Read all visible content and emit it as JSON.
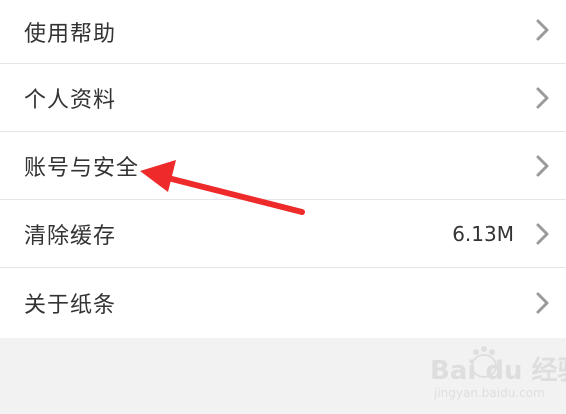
{
  "menu": {
    "items": [
      {
        "label": "使用帮助"
      },
      {
        "label": "个人资料"
      },
      {
        "label": "账号与安全"
      },
      {
        "label": "清除缓存",
        "value": "6.13M"
      },
      {
        "label": "关于纸条"
      }
    ]
  },
  "watermark": {
    "main": "Bai du 经验",
    "sub": "jingyan.baidu.com"
  },
  "colors": {
    "annotation_arrow": "#ee2a2a",
    "chevron": "#9a9a9a",
    "background": "#f2f2f2"
  }
}
